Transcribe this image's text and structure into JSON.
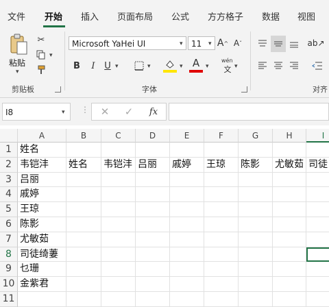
{
  "ribbon_tabs": [
    "文件",
    "开始",
    "插入",
    "页面布局",
    "公式",
    "方方格子",
    "数据",
    "视图"
  ],
  "active_tab": "开始",
  "clipboard": {
    "paste_label": "粘贴",
    "group_label": "剪贴板"
  },
  "font": {
    "family": "Microsoft YaHei UI",
    "size": "11",
    "group_label": "字体",
    "bold": "B",
    "italic": "I",
    "underline": "U",
    "phonetic_top": "wén"
  },
  "alignment": {
    "group_label": "对齐"
  },
  "formula_bar": {
    "name_box": "I8",
    "fx": "fx",
    "value": ""
  },
  "columns": [
    "A",
    "B",
    "C",
    "D",
    "E",
    "F",
    "G",
    "H",
    "I"
  ],
  "rows": [
    "1",
    "2",
    "3",
    "4",
    "5",
    "6",
    "7",
    "8",
    "9",
    "10",
    "11"
  ],
  "cells": {
    "A1": "姓名",
    "A2": "韦铠沣",
    "A3": "吕丽",
    "A4": "戚婷",
    "A5": "王琼",
    "A6": "陈影",
    "A7": "尤敏茹",
    "A8": "司徒绮萋",
    "A9": "乜珊",
    "A10": "金紫君",
    "A11": "",
    "B2": "姓名",
    "C2": "韦铠沣",
    "D2": "吕丽",
    "E2": "戚婷",
    "F2": "王琼",
    "G2": "陈影",
    "H2": "尤敏茹",
    "I2": "司徒"
  },
  "selected_cell": "I8",
  "accent_color": "#217346",
  "font_color_bar": "#e00000",
  "highlight_color_bar": "#ffe600"
}
